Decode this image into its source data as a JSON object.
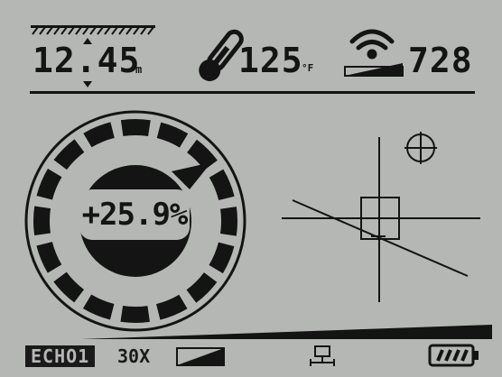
{
  "depth": {
    "value": "12.45",
    "unit": "m"
  },
  "temperature": {
    "value": "125",
    "unit": "°F"
  },
  "signal": {
    "value": "728"
  },
  "gauge": {
    "reading": "+25.9%"
  },
  "status_bar": {
    "mode_label": "ECHO1",
    "zoom_label": "30X"
  },
  "colors": {
    "lcd_background": "#b5b7b5",
    "ink": "#141414"
  },
  "icons": [
    "depth-scale-icon",
    "thermometer-icon",
    "wifi-signal-icon",
    "crosshair-circle-icon",
    "network-icon",
    "battery-icon"
  ]
}
